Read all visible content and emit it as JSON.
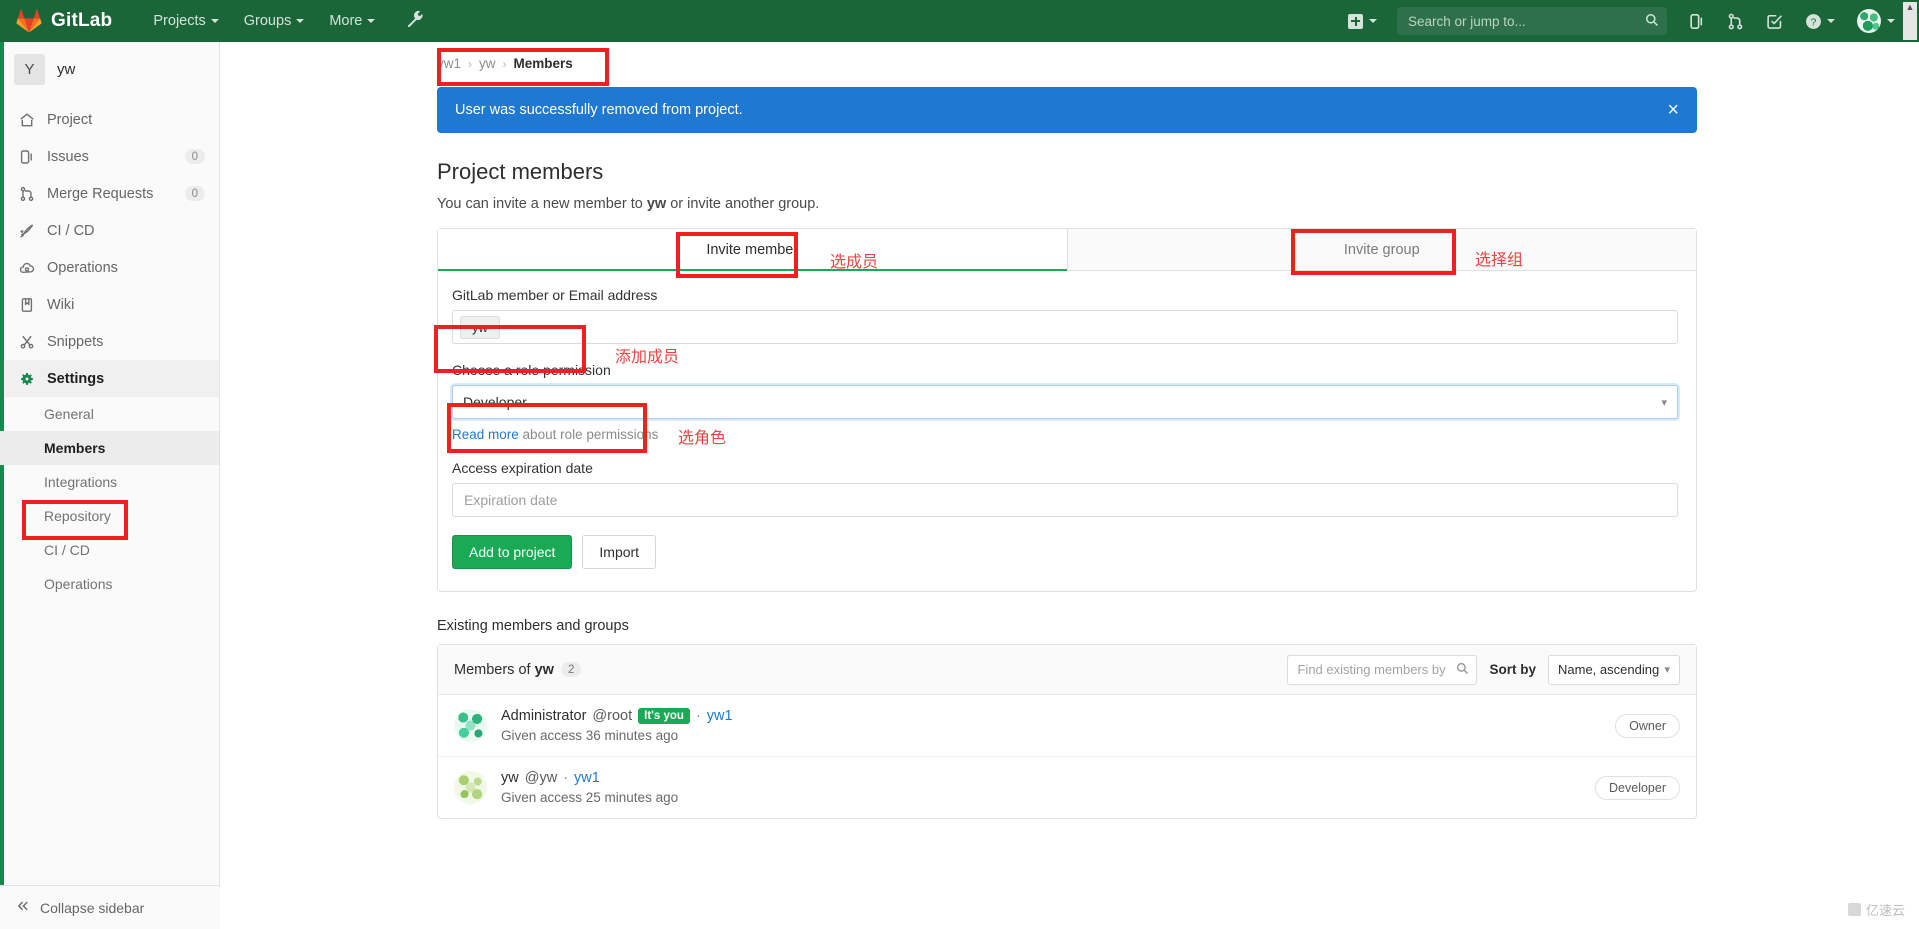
{
  "topnav": {
    "brand": "GitLab",
    "items": [
      {
        "label": "Projects",
        "name": "nav-projects"
      },
      {
        "label": "Groups",
        "name": "nav-groups"
      },
      {
        "label": "More",
        "name": "nav-more"
      }
    ],
    "wrench_icon": "wrench-icon",
    "plus_icon": "plus-icon",
    "search_placeholder": "Search or jump to...",
    "search_value": "",
    "icons": [
      "issues-icon",
      "merge-requests-icon",
      "todos-icon",
      "help-icon",
      "avatar-icon"
    ]
  },
  "sidebar": {
    "project_initial": "Y",
    "project_name": "yw",
    "items": [
      {
        "label": "Project",
        "icon": "home-icon",
        "badge": ""
      },
      {
        "label": "Issues",
        "icon": "issues-icon",
        "badge": "0"
      },
      {
        "label": "Merge Requests",
        "icon": "merge-requests-icon",
        "badge": "0"
      },
      {
        "label": "CI / CD",
        "icon": "rocket-icon",
        "badge": ""
      },
      {
        "label": "Operations",
        "icon": "cloud-gear-icon",
        "badge": ""
      },
      {
        "label": "Wiki",
        "icon": "book-icon",
        "badge": ""
      },
      {
        "label": "Snippets",
        "icon": "scissors-icon",
        "badge": ""
      },
      {
        "label": "Settings",
        "icon": "gear-icon",
        "badge": ""
      }
    ],
    "settings_subitems": [
      {
        "label": "General"
      },
      {
        "label": "Members"
      },
      {
        "label": "Integrations"
      },
      {
        "label": "Repository"
      },
      {
        "label": "CI / CD"
      },
      {
        "label": "Operations"
      }
    ],
    "collapse_label": "Collapse sidebar"
  },
  "breadcrumb": {
    "items": [
      "yw1",
      "yw",
      "Members"
    ],
    "separator": "›"
  },
  "alert": {
    "message": "User was successfully removed from project.",
    "close_icon": "close-icon",
    "color": "#1f78d1"
  },
  "page": {
    "title": "Project members",
    "subtitle_pre": "You can invite a new member to ",
    "subtitle_bold": "yw",
    "subtitle_post": " or invite another group."
  },
  "tabs": [
    {
      "label": "Invite member",
      "active": true
    },
    {
      "label": "Invite group",
      "active": false
    }
  ],
  "form": {
    "member_label": "GitLab member or Email address",
    "member_token": "yw",
    "role_label": "Choose a role permission",
    "role_value": "Developer",
    "readmore_link": "Read more",
    "readmore_rest": " about role permissions",
    "expiration_label": "Access expiration date",
    "expiration_placeholder": "Expiration date",
    "expiration_value": "",
    "submit_label": "Add to project",
    "import_label": "Import"
  },
  "existing": {
    "heading": "Existing members and groups",
    "members_of_pre": "Members of ",
    "members_of_bold": "yw",
    "count": "2",
    "find_placeholder": "Find existing members by name",
    "find_value": "",
    "sort_label": "Sort by",
    "sort_value": "Name, ascending",
    "rows": [
      {
        "name": "Administrator",
        "username": "@root",
        "you_badge": "It's you",
        "dot": "·",
        "group": "yw1",
        "access": "Given access 36 minutes ago",
        "role": "Owner"
      },
      {
        "name": "yw",
        "username": "@yw",
        "you_badge": "",
        "dot": "·",
        "group": "yw1",
        "access": "Given access 25 minutes ago",
        "role": "Developer"
      }
    ]
  },
  "annotations": [
    {
      "text": "选成员",
      "name": "annotation-select-member"
    },
    {
      "text": "选择组",
      "name": "annotation-select-group"
    },
    {
      "text": "添加成员",
      "name": "annotation-add-member"
    },
    {
      "text": "选角色",
      "name": "annotation-select-role"
    }
  ],
  "watermark": {
    "text": "亿速云"
  }
}
